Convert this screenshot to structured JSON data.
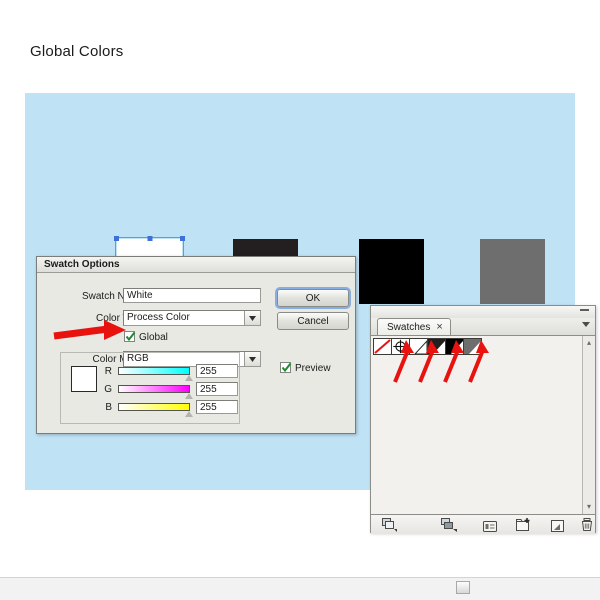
{
  "page": {
    "title": "Global Colors"
  },
  "artboard": {
    "background_color": "#bfe2f5",
    "squares": [
      {
        "name": "white-square",
        "color": "#ffffff",
        "selected": true
      },
      {
        "name": "dark-square",
        "color": "#231f20",
        "selected": false
      },
      {
        "name": "black-square",
        "color": "#000000",
        "selected": false
      },
      {
        "name": "gray-square",
        "color": "#6e6e6e",
        "selected": false
      }
    ],
    "selection_color": "#3f6fd8"
  },
  "dialog": {
    "title": "Swatch Options",
    "swatch_name_label": "Swatch Name:",
    "swatch_name_value": "White",
    "color_type_label": "Color Type:",
    "color_type_value": "Process Color",
    "global_label": "Global",
    "global_checked": true,
    "color_mode_label": "Color Mode:",
    "color_mode_value": "RGB",
    "preview_label": "Preview",
    "preview_checked": true,
    "ok_label": "OK",
    "cancel_label": "Cancel",
    "preview_swatch_color": "#ffffff",
    "channels": [
      {
        "label": "R",
        "value": "255",
        "track_start": "#ffffff",
        "track_end": "#00ffff"
      },
      {
        "label": "G",
        "value": "255",
        "track_start": "#ffffff",
        "track_end": "#ff00ff"
      },
      {
        "label": "B",
        "value": "255",
        "track_start": "#ffffff",
        "track_end": "#ffff00"
      }
    ]
  },
  "swatches_panel": {
    "tab_label": "Swatches",
    "tab_close_glyph": "×",
    "swatches": [
      {
        "name": "none-swatch",
        "color": "#ffffff",
        "kind": "none",
        "global": false
      },
      {
        "name": "registration-swatch",
        "color": "#ffffff",
        "kind": "registration",
        "global": false
      },
      {
        "name": "white-swatch",
        "color": "#ffffff",
        "kind": "color",
        "global": true
      },
      {
        "name": "dark-swatch",
        "color": "#231f20",
        "kind": "color",
        "global": true
      },
      {
        "name": "black-swatch",
        "color": "#000000",
        "kind": "color",
        "global": true
      },
      {
        "name": "gray-swatch",
        "color": "#6e6e6e",
        "kind": "color",
        "global": true
      }
    ],
    "footer_buttons": [
      "swatch-libraries-menu",
      "show-swatch-kinds-menu",
      "swatch-options",
      "new-color-group",
      "new-swatch",
      "delete-swatch"
    ]
  },
  "annotations": {
    "arrow_color": "#e8130f",
    "global_checkbox_arrow": "points-right-at-global-checkbox",
    "swatch_arrows_count": 4
  }
}
